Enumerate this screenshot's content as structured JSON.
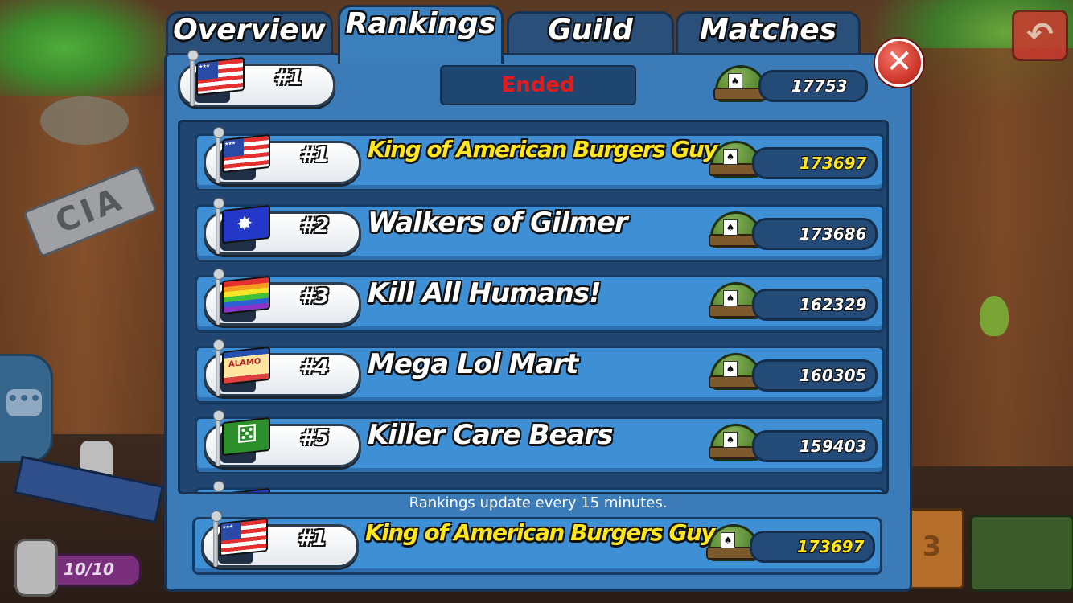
{
  "tabs": [
    {
      "label": "Overview"
    },
    {
      "label": "Rankings"
    },
    {
      "label": "Guild"
    },
    {
      "label": "Matches"
    }
  ],
  "active_tab": "Rankings",
  "header": {
    "my_rank": "#1",
    "status": "Ended",
    "my_score": "17753"
  },
  "rankings": [
    {
      "rank": "#1",
      "name": "King of American Burgers Guy",
      "score": "173697",
      "flag": "us-flag"
    },
    {
      "rank": "#2",
      "name": "Walkers of Gilmer",
      "score": "173686",
      "flag": "eagle-flag"
    },
    {
      "rank": "#3",
      "name": "Kill All Humans!",
      "score": "162329",
      "flag": "rainbow-flag"
    },
    {
      "rank": "#4",
      "name": "Mega Lol Mart",
      "score": "160305",
      "flag": "alamo-flag"
    },
    {
      "rank": "#5",
      "name": "Killer Care Bears",
      "score": "159403",
      "flag": "dice-flag"
    }
  ],
  "update_note": "Rankings update every 15 minutes.",
  "my_guild": {
    "rank": "#1",
    "name": "King of American Burgers Guy",
    "score": "173697"
  },
  "background": {
    "cia_sign": "CIA",
    "energy": "10/10",
    "podium_number": "3"
  },
  "colors": {
    "highlight_name": "#ffe61f",
    "status_red": "#e01c1c",
    "panel_blue": "#3a7bb8"
  }
}
